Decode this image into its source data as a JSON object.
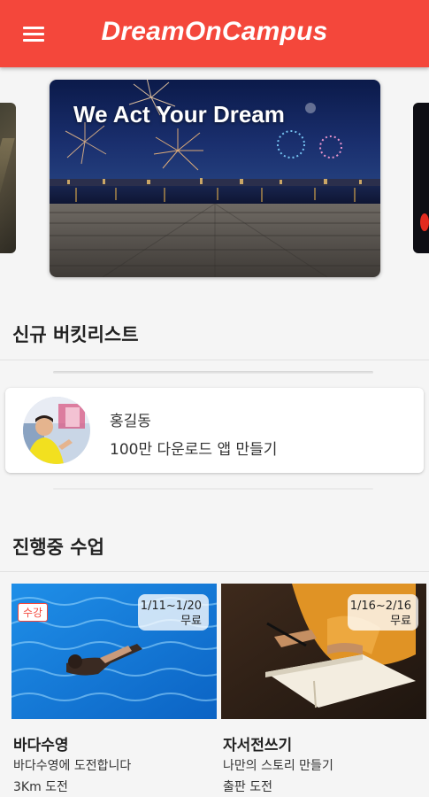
{
  "appbar": {
    "title": "DreamOnCampus",
    "menu_icon": "hamburger-menu-icon",
    "color": "#f4473b"
  },
  "banner": {
    "headline": "We Act Your Dream"
  },
  "new_bucketlist": {
    "title": "신규 버킷리스트",
    "items": [
      {
        "name": "홍길동",
        "goal": "100만 다운로드 앱 만들기"
      }
    ]
  },
  "ongoing_classes": {
    "title": "진행중 수업",
    "items": [
      {
        "title": "바다수영",
        "desc": "바다수영에 도전합니다",
        "sub": "3Km 도전",
        "dates": "1/11~1/20",
        "price": "무료",
        "tag": "수강"
      },
      {
        "title": "자서전쓰기",
        "desc": "나만의 스토리 만들기",
        "sub": "출판 도전",
        "dates": "1/16~2/16",
        "price": "무료"
      }
    ]
  }
}
